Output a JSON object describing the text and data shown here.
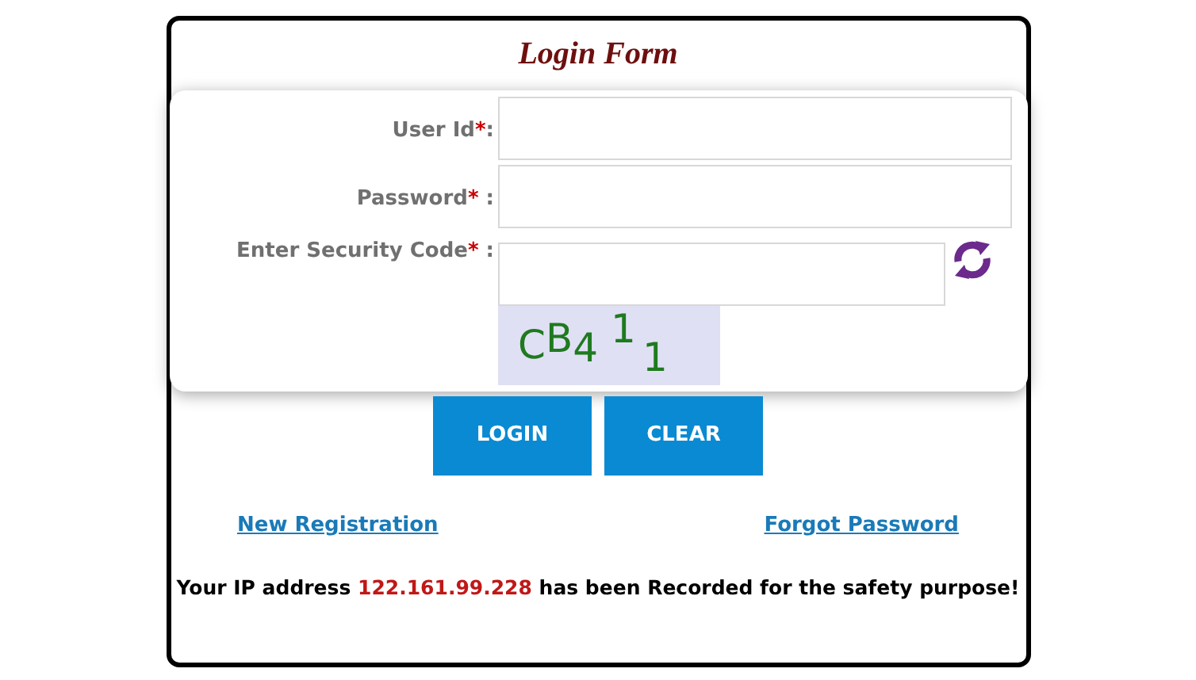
{
  "title": "Login Form",
  "fields": [
    {
      "label": "User Id",
      "asterisk": "*",
      "separator": ":",
      "kind": "text"
    },
    {
      "label": "Password",
      "asterisk": "*",
      "separator": " :",
      "kind": "password"
    },
    {
      "label": "Enter Security Code",
      "asterisk": "*",
      "separator": " :",
      "kind": "captcha"
    }
  ],
  "captcha": [
    "C",
    "B",
    "4",
    "1",
    "1"
  ],
  "buttons": [
    "LOGIN",
    "CLEAR"
  ],
  "links": [
    "New Registration",
    "Forgot Password"
  ],
  "notice": {
    "prefix": "Your IP address ",
    "ip": "122.161.99.228",
    "suffix": " has been Recorded for the safety purpose!"
  }
}
